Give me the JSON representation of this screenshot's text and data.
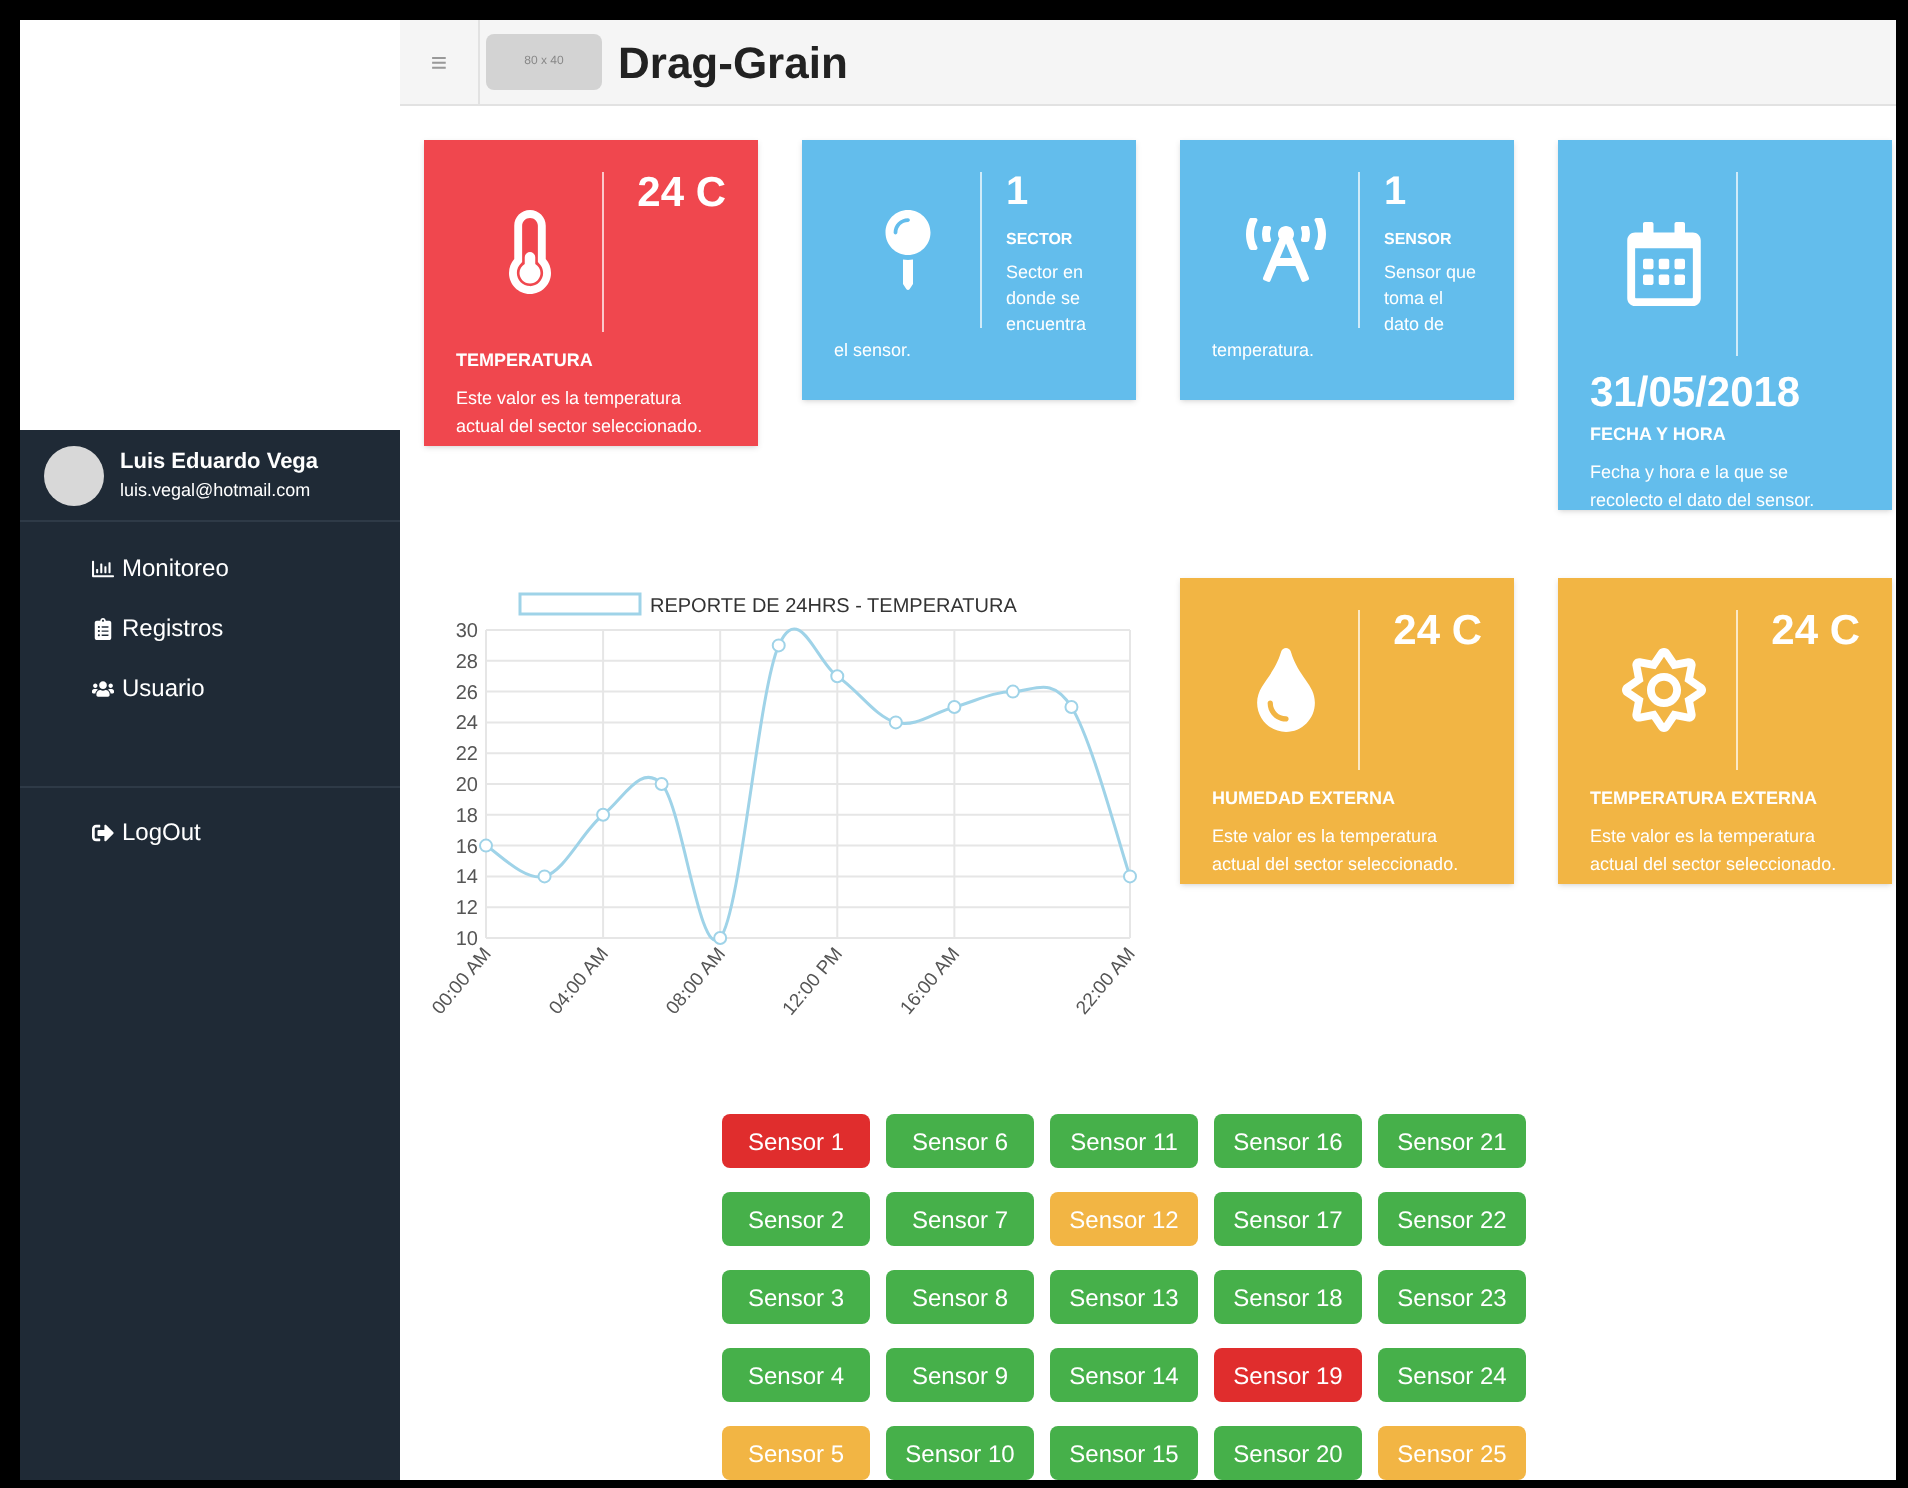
{
  "header": {
    "menu_icon": "≡",
    "logo_placeholder": "80 x 40",
    "title": "Drag-Grain"
  },
  "sidebar": {
    "user": {
      "name": "Luis Eduardo Vega",
      "email": "luis.vegal@hotmail.com"
    },
    "items": [
      {
        "label": "Monitoreo"
      },
      {
        "label": "Registros"
      },
      {
        "label": "Usuario"
      }
    ],
    "logout": {
      "label": "LogOut"
    }
  },
  "cards": [
    {
      "kind": "metric",
      "color": "#f0474e",
      "value": "24 C",
      "label": "TEMPERATURA",
      "description": "Este valor es la temperatura actual del sector seleccionado."
    },
    {
      "kind": "info",
      "color": "#63bdec",
      "value": "1",
      "label": "SECTOR",
      "description": "Sector en donde se encuentra el sensor."
    },
    {
      "kind": "info",
      "color": "#63bdec",
      "value": "1",
      "label": "SENSOR",
      "description": "Sensor que toma el dato de temperatura."
    },
    {
      "kind": "date",
      "color": "#63bdec",
      "value": "31/05/2018",
      "label": "FECHA Y HORA",
      "description": "Fecha y hora e la que se recolecto el dato del sensor."
    }
  ],
  "chart_data": {
    "type": "line",
    "categories": [
      "00:00 AM",
      null,
      "04:00 AM",
      null,
      "08:00 AM",
      null,
      "12:00 PM",
      null,
      "16:00 AM",
      null,
      null,
      "22:00 AM"
    ],
    "grid": true,
    "series": [
      {
        "name": "REPORTE DE 24HRS - TEMPERATURA",
        "color": "#9fd3e8",
        "marker": "circle",
        "values": [
          16,
          14,
          18,
          20,
          10,
          29,
          27,
          24,
          25,
          26,
          25,
          14
        ]
      }
    ],
    "ylim": [
      10,
      30
    ],
    "yticks": [
      10,
      12,
      14,
      16,
      18,
      20,
      22,
      24,
      26,
      28,
      30
    ]
  },
  "external_cards": [
    {
      "kind": "metric",
      "color": "#f2b544",
      "value": "24 C",
      "label": "HUMEDAD EXTERNA",
      "description": "Este valor es la temperatura actual del sector seleccionado."
    },
    {
      "kind": "metric",
      "color": "#f2b544",
      "value": "24 C",
      "label": "TEMPERATURA EXTERNA",
      "description": "Este valor es la temperatura actual del sector seleccionado."
    }
  ],
  "sensors": [
    {
      "label": "Sensor 1",
      "color": "#e02d2d"
    },
    {
      "label": "Sensor 2",
      "color": "#46b04a"
    },
    {
      "label": "Sensor 3",
      "color": "#46b04a"
    },
    {
      "label": "Sensor 4",
      "color": "#46b04a"
    },
    {
      "label": "Sensor 5",
      "color": "#f2b544"
    },
    {
      "label": "Sensor 6",
      "color": "#46b04a"
    },
    {
      "label": "Sensor 7",
      "color": "#46b04a"
    },
    {
      "label": "Sensor 8",
      "color": "#46b04a"
    },
    {
      "label": "Sensor 9",
      "color": "#46b04a"
    },
    {
      "label": "Sensor 10",
      "color": "#46b04a"
    },
    {
      "label": "Sensor 11",
      "color": "#46b04a"
    },
    {
      "label": "Sensor 12",
      "color": "#f2b544"
    },
    {
      "label": "Sensor 13",
      "color": "#46b04a"
    },
    {
      "label": "Sensor 14",
      "color": "#46b04a"
    },
    {
      "label": "Sensor 15",
      "color": "#46b04a"
    },
    {
      "label": "Sensor 16",
      "color": "#46b04a"
    },
    {
      "label": "Sensor 17",
      "color": "#46b04a"
    },
    {
      "label": "Sensor 18",
      "color": "#46b04a"
    },
    {
      "label": "Sensor 19",
      "color": "#e02d2d"
    },
    {
      "label": "Sensor 20",
      "color": "#46b04a"
    },
    {
      "label": "Sensor 21",
      "color": "#46b04a"
    },
    {
      "label": "Sensor 22",
      "color": "#46b04a"
    },
    {
      "label": "Sensor 23",
      "color": "#46b04a"
    },
    {
      "label": "Sensor 24",
      "color": "#46b04a"
    },
    {
      "label": "Sensor 25",
      "color": "#f2b544"
    }
  ]
}
